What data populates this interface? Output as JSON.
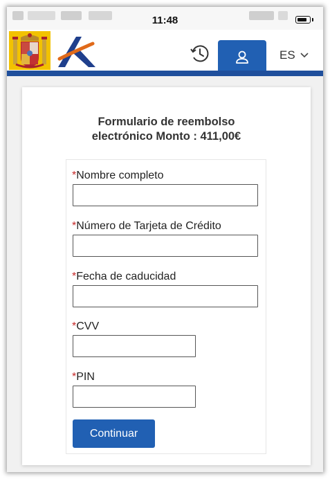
{
  "status_bar": {
    "time": "11:48"
  },
  "header": {
    "language": "ES",
    "colors": {
      "accent": "#2160b3",
      "bar": "#1f4f9c"
    },
    "icons": [
      "spain-coat-of-arms-logo",
      "agencia-tributaria-logo",
      "clock-icon",
      "user-icon",
      "chevron-down-icon"
    ]
  },
  "form": {
    "title_line1": "Formulario de reembolso",
    "title_line2": "electrónico Monto : 411,00€",
    "required_mark": "*",
    "fields": [
      {
        "label": "Nombre completo",
        "value": ""
      },
      {
        "label": "Número de Tarjeta de Crédito",
        "value": ""
      },
      {
        "label": "Fecha de caducidad",
        "value": ""
      },
      {
        "label": "CVV",
        "value": ""
      },
      {
        "label": "PIN",
        "value": ""
      }
    ],
    "submit_label": "Continuar"
  }
}
